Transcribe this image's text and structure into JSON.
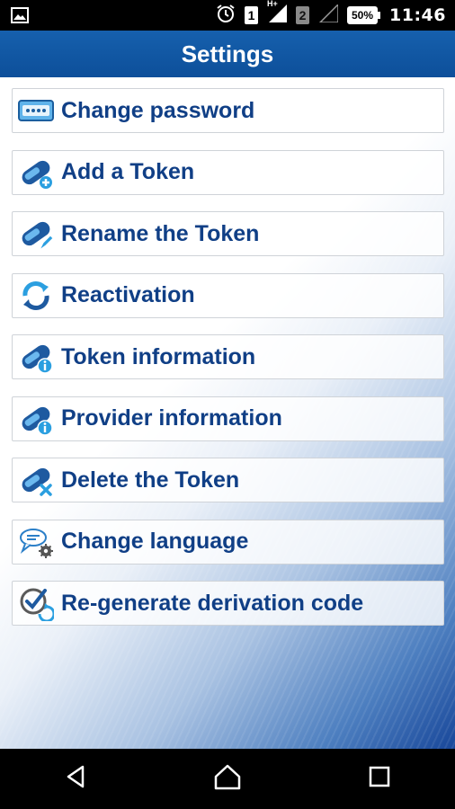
{
  "statusbar": {
    "time": "11:46",
    "battery": "50%",
    "sim1": "1",
    "sim2": "2",
    "network": "H+"
  },
  "header": {
    "title": "Settings"
  },
  "menu": {
    "items": [
      {
        "label": "Change password",
        "icon": "keypad-password-icon"
      },
      {
        "label": "Add a Token",
        "icon": "token-add-icon"
      },
      {
        "label": "Rename the Token",
        "icon": "token-rename-icon"
      },
      {
        "label": "Reactivation",
        "icon": "refresh-icon"
      },
      {
        "label": "Token information",
        "icon": "token-info-icon"
      },
      {
        "label": "Provider information",
        "icon": "provider-info-icon"
      },
      {
        "label": "Delete the Token",
        "icon": "token-delete-icon"
      },
      {
        "label": "Change language",
        "icon": "language-settings-icon"
      },
      {
        "label": "Re-generate derivation code",
        "icon": "regenerate-code-icon"
      }
    ]
  },
  "navigation": {
    "back": "back-icon",
    "home": "home-icon",
    "recents": "recents-icon"
  },
  "colors": {
    "header": "#1660ad",
    "label": "#103f86",
    "accent": "#2b9fe0"
  }
}
